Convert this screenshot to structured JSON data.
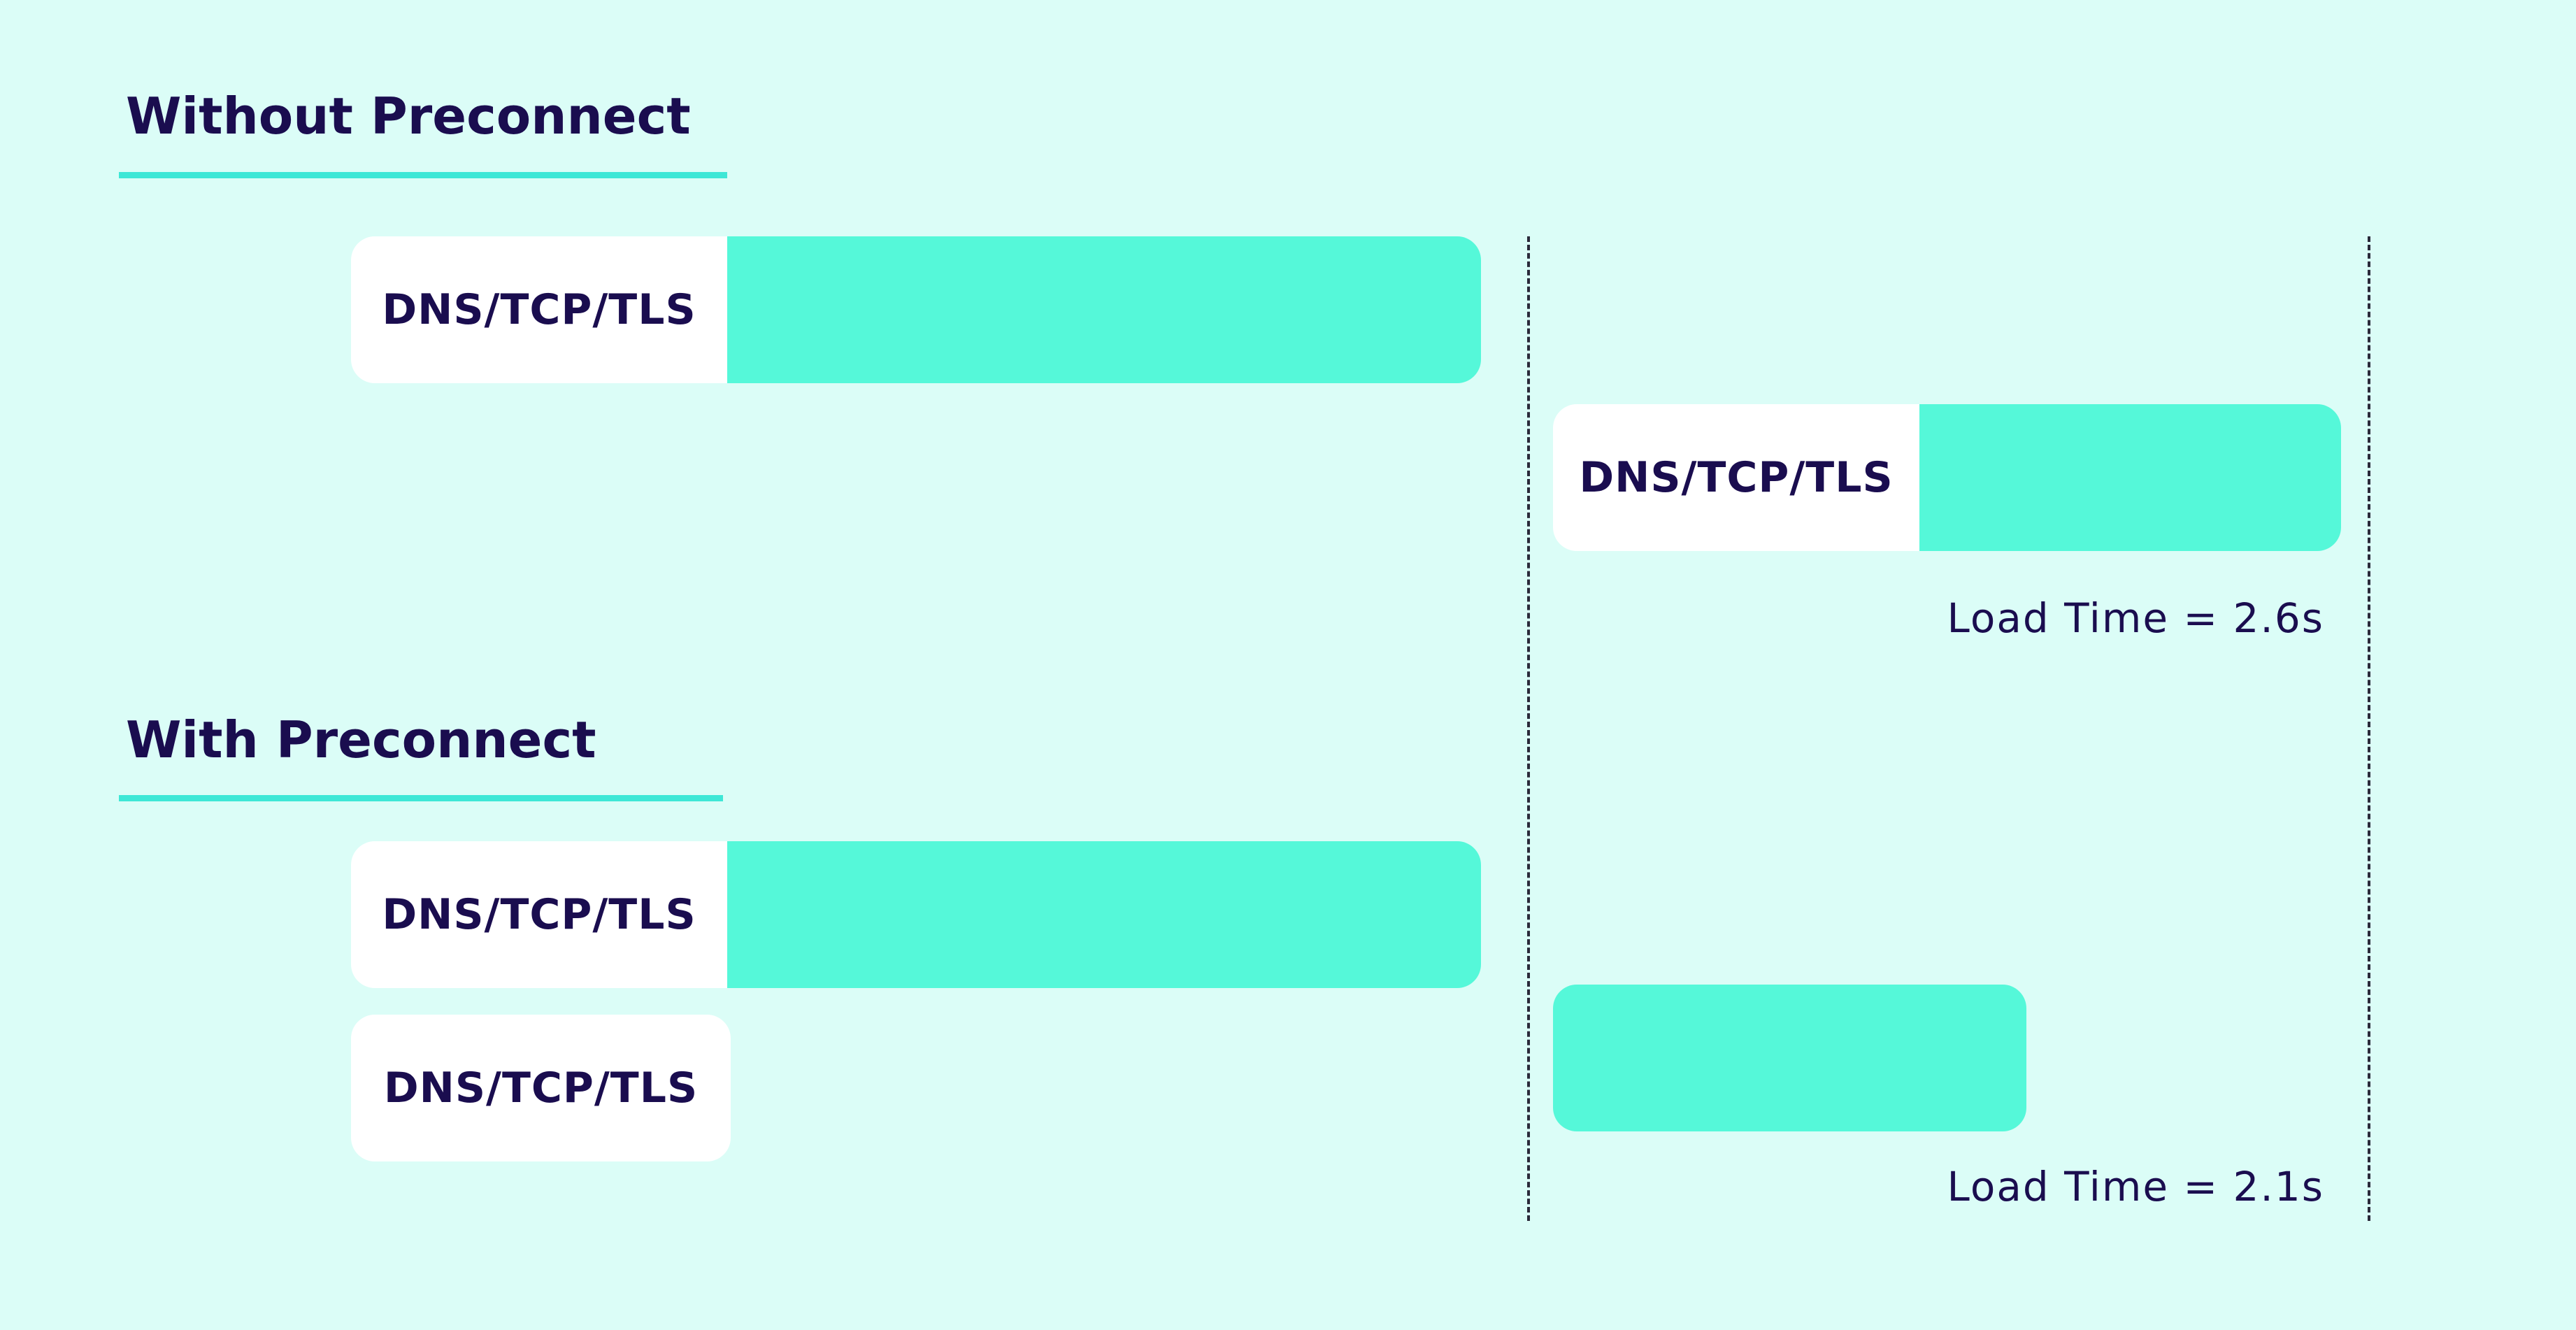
{
  "colors": {
    "background": "#dbfdf7",
    "accent": "#55f8d9",
    "underline": "#3ee7d6",
    "text": "#1a0d4f",
    "label_bg": "#ffffff"
  },
  "without": {
    "title": "Without Preconnect",
    "bar1_label": "DNS/TCP/TLS",
    "bar2_label": "DNS/TCP/TLS",
    "load_time": "Load Time = 2.6s"
  },
  "with": {
    "title": "With Preconnect",
    "bar1_label": "DNS/TCP/TLS",
    "bar2_label": "DNS/TCP/TLS",
    "load_time": "Load Time = 2.1s"
  }
}
